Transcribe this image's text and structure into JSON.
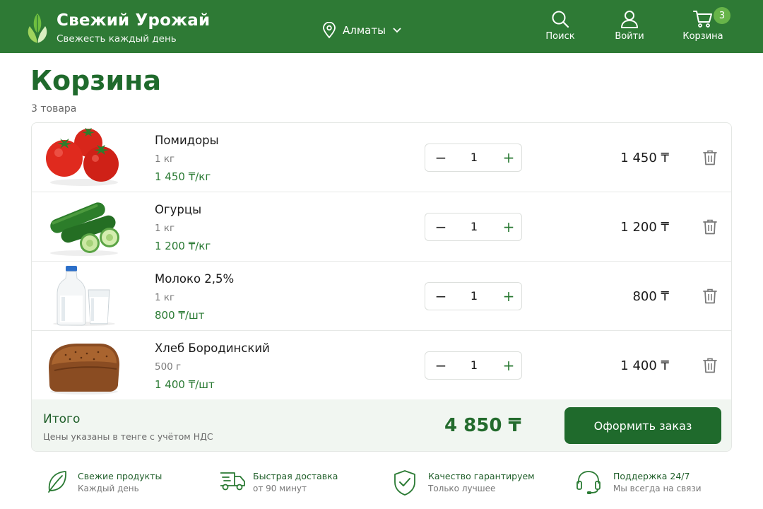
{
  "header": {
    "brand_title": "Свежий Урожай",
    "brand_subtitle": "Свежесть каждый день",
    "location": "Алматы",
    "search_label": "Поиск",
    "login_label": "Войти",
    "cart_label": "Корзина",
    "cart_count": "3",
    "colors": {
      "background": "#2e7a35",
      "badge": "#67b449"
    }
  },
  "page": {
    "title": "Корзина",
    "items_count": "3 товара"
  },
  "cart": {
    "items": [
      {
        "name": "Помидоры",
        "unit": "1 кг",
        "unit_price": "1 450 ₸/кг",
        "quantity": "1",
        "total": "1 450 ₸",
        "image_icon": "tomatoes-image"
      },
      {
        "name": "Огурцы",
        "unit": "1 кг",
        "unit_price": "1 200 ₸/кг",
        "quantity": "1",
        "total": "1 200 ₸",
        "image_icon": "cucumbers-image"
      },
      {
        "name": "Молоко 2,5%",
        "unit": "1 кг",
        "unit_price": "800 ₸/шт",
        "quantity": "1",
        "total": "800 ₸",
        "image_icon": "milk-image"
      },
      {
        "name": "Хлеб Бородинский",
        "unit": "500 г",
        "unit_price": "1 400 ₸/шт",
        "quantity": "1",
        "total": "1 400 ₸",
        "image_icon": "bread-image"
      }
    ],
    "stepper": {
      "minus": "−",
      "plus": "+"
    }
  },
  "summary": {
    "title": "Итого",
    "note": "Цены указаны в тенге с учётом НДС",
    "total": "4 850 ₸",
    "checkout_label": "Оформить заказ",
    "colors": {
      "accent": "#1f6a2c",
      "panel": "#f1f6f1"
    }
  },
  "features": [
    {
      "title": "Свежие продукты",
      "subtitle": "Каждый день",
      "icon": "leaf-icon"
    },
    {
      "title": "Быстрая доставка",
      "subtitle": "от 90 минут",
      "icon": "truck-icon"
    },
    {
      "title": "Качество гарантируем",
      "subtitle": "Только лучшее",
      "icon": "shield-check-icon"
    },
    {
      "title": "Поддержка 24/7",
      "subtitle": "Мы всегда на связи",
      "icon": "headset-icon"
    }
  ]
}
